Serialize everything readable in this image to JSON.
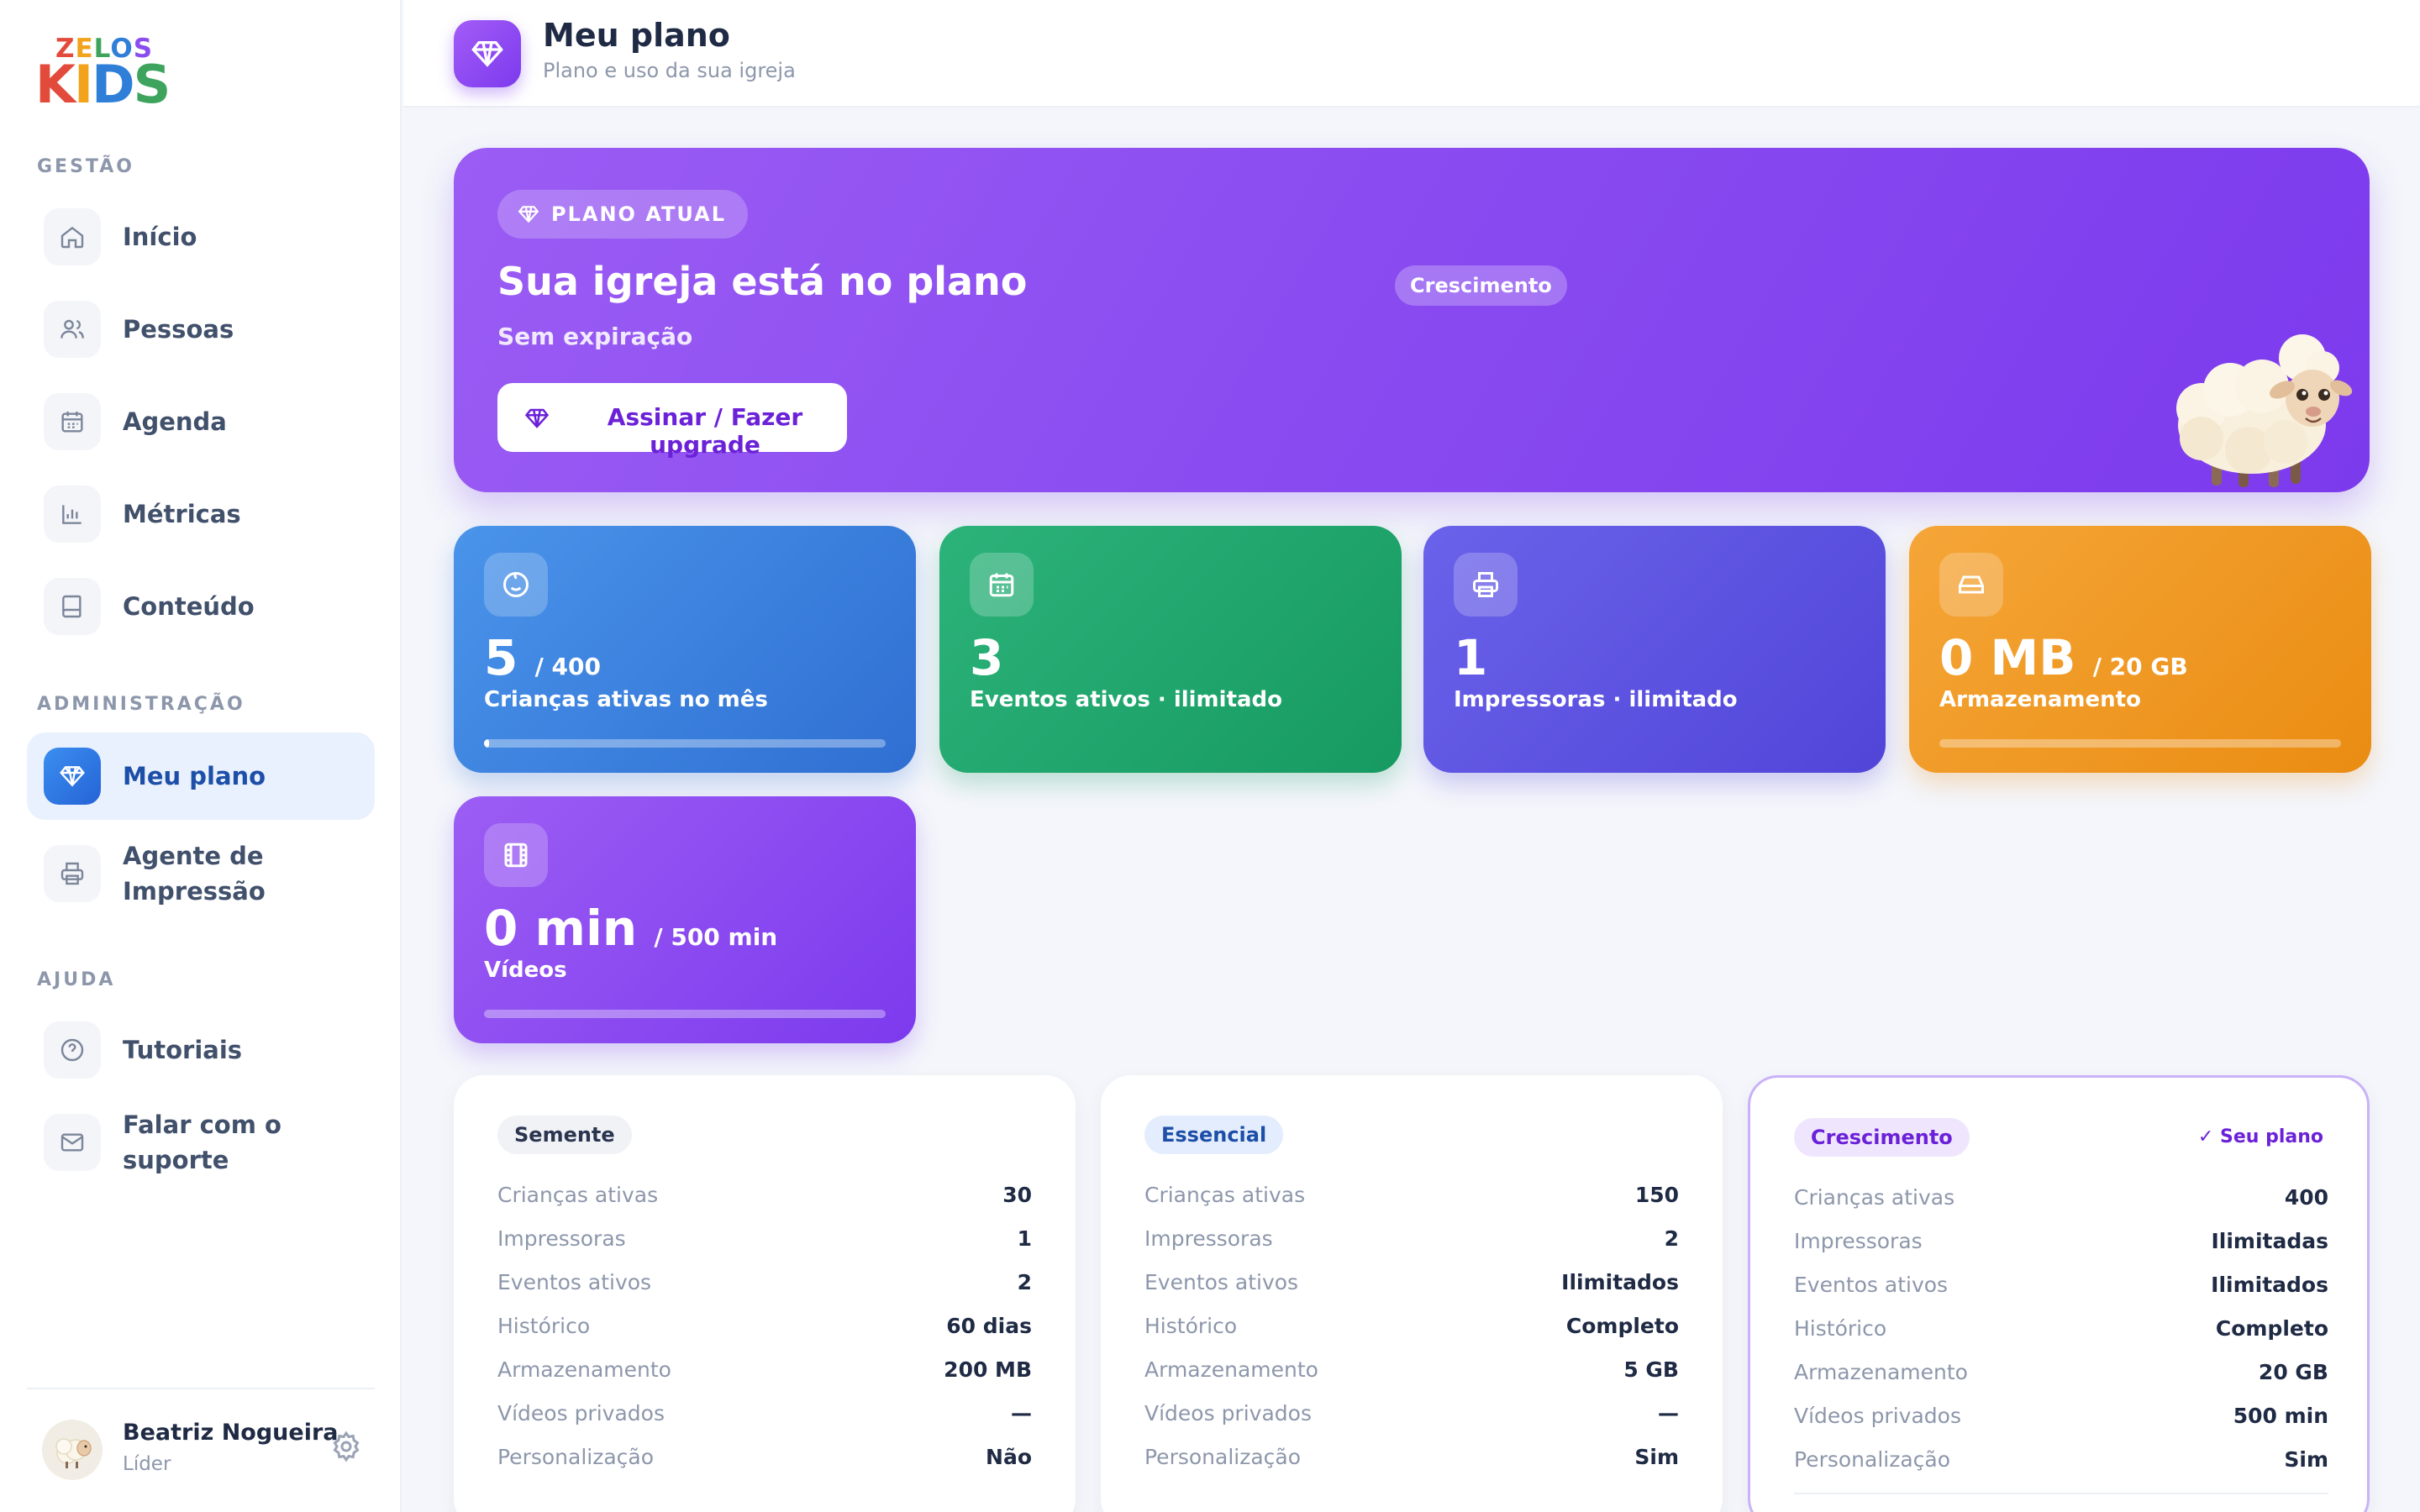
{
  "brand": {
    "logo_top": "ZELOS",
    "logo_bottom": "KIDS"
  },
  "sidebar": {
    "sections": {
      "gestao": "GESTÃO",
      "admin": "ADMINISTRAÇÃO",
      "ajuda": "AJUDA"
    },
    "items": [
      {
        "label": "Início",
        "icon": "home-icon"
      },
      {
        "label": "Pessoas",
        "icon": "users-icon"
      },
      {
        "label": "Agenda",
        "icon": "calendar-icon"
      },
      {
        "label": "Métricas",
        "icon": "bar-chart-icon"
      },
      {
        "label": "Conteúdo",
        "icon": "book-icon"
      },
      {
        "label": "Meu plano",
        "icon": "diamond-icon",
        "active": true
      },
      {
        "label": "Agente de\nImpressão",
        "icon": "printer-icon"
      },
      {
        "label": "Tutoriais",
        "icon": "help-icon"
      },
      {
        "label": "Falar com o suporte",
        "icon": "mail-icon"
      }
    ],
    "user": {
      "name": "Beatriz Nogueira",
      "role": "Líder"
    }
  },
  "header": {
    "title": "Meu plano",
    "subtitle": "Plano e uso da sua igreja"
  },
  "hero": {
    "badge": "PLANO ATUAL",
    "title": "Sua igreja está no plano",
    "plan_name": "Crescimento",
    "expiry": "Sem expiração",
    "button_label": "Assinar / Fazer upgrade"
  },
  "stats": [
    {
      "value": "5",
      "limit": "/ 400",
      "label": "Crianças ativas no mês",
      "progress": 0.0125,
      "icon": "smile-icon",
      "color": "#3b82e0"
    },
    {
      "value": "3",
      "limit": "",
      "label": "Eventos ativos · ilimitado",
      "icon": "calendar-icon",
      "color": "#1fa76c"
    },
    {
      "value": "1",
      "limit": "",
      "label": "Impressoras · ilimitado",
      "icon": "printer-icon",
      "color": "#5d55e2"
    },
    {
      "value": "0 MB",
      "limit": "/ 20 GB",
      "label": "Armazenamento",
      "progress": 0,
      "icon": "hard-drive-icon",
      "color": "#ef9a22"
    },
    {
      "value": "0 min",
      "limit": "/ 500 min",
      "label": "Vídeos",
      "progress": 0,
      "icon": "film-icon",
      "color": "#8b4cf0"
    }
  ],
  "plans": [
    {
      "name": "Semente",
      "rows": [
        [
          "Crianças ativas",
          "30"
        ],
        [
          "Impressoras",
          "1"
        ],
        [
          "Eventos ativos",
          "2"
        ],
        [
          "Histórico",
          "60 dias"
        ],
        [
          "Armazenamento",
          "200 MB"
        ],
        [
          "Vídeos privados",
          "—"
        ],
        [
          "Personalização",
          "Não"
        ]
      ]
    },
    {
      "name": "Essencial",
      "rows": [
        [
          "Crianças ativas",
          "150"
        ],
        [
          "Impressoras",
          "2"
        ],
        [
          "Eventos ativos",
          "Ilimitados"
        ],
        [
          "Histórico",
          "Completo"
        ],
        [
          "Armazenamento",
          "5 GB"
        ],
        [
          "Vídeos privados",
          "—"
        ],
        [
          "Personalização",
          "Sim"
        ]
      ]
    },
    {
      "name": "Crescimento",
      "current_label": "✓ Seu plano",
      "rows": [
        [
          "Crianças ativas",
          "400"
        ],
        [
          "Impressoras",
          "Ilimitadas"
        ],
        [
          "Eventos ativos",
          "Ilimitados"
        ],
        [
          "Histórico",
          "Completo"
        ],
        [
          "Armazenamento",
          "20 GB"
        ],
        [
          "Vídeos privados",
          "500 min"
        ],
        [
          "Personalização",
          "Sim"
        ]
      ]
    }
  ]
}
